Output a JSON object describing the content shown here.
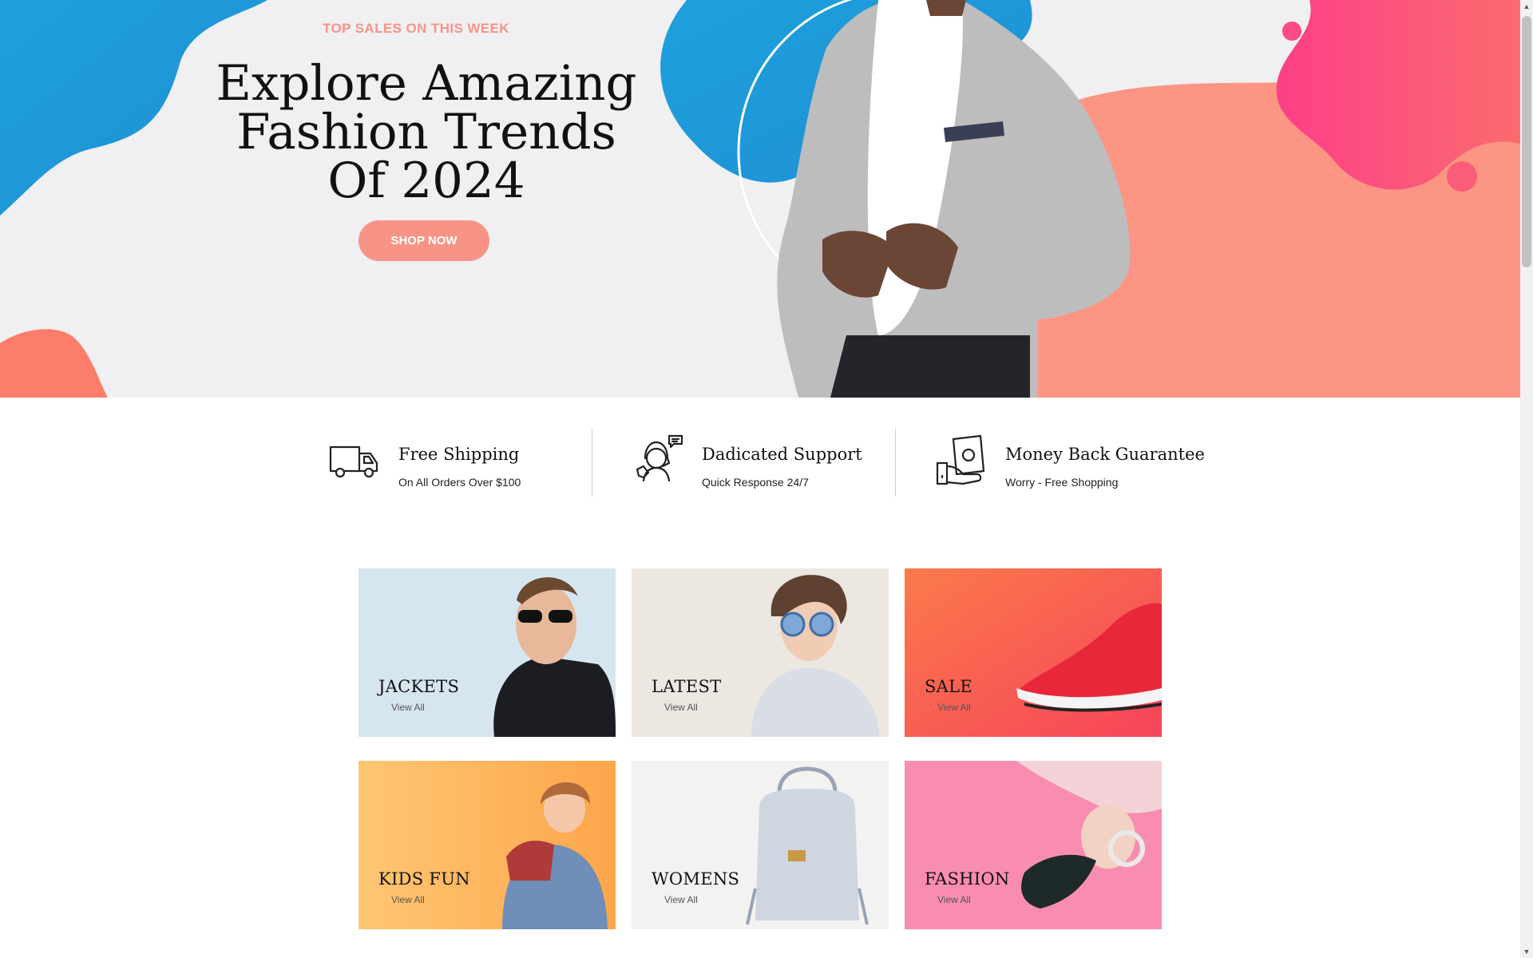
{
  "hero": {
    "eyebrow": "TOP SALES ON THIS WEEK",
    "title_lines": [
      "Explore Amazing",
      "Fashion Trends",
      "Of 2024"
    ],
    "cta_label": "SHOP NOW"
  },
  "features": [
    {
      "icon": "delivery-truck-icon",
      "title": "Free Shipping",
      "subtitle": "On All Orders Over $100"
    },
    {
      "icon": "support-agent-icon",
      "title": "Dadicated Support",
      "subtitle": "Quick Response 24/7"
    },
    {
      "icon": "money-back-icon",
      "title": "Money Back Guarantee",
      "subtitle": "Worry - Free Shopping"
    }
  ],
  "categories": [
    {
      "name": "JACKETS",
      "link": "View All"
    },
    {
      "name": "LATEST",
      "link": "View All"
    },
    {
      "name": "SALE",
      "link": "View All"
    },
    {
      "name": "KIDS FUN",
      "link": "View All"
    },
    {
      "name": "WOMENS",
      "link": "View All"
    },
    {
      "name": "FASHION",
      "link": "View All"
    }
  ],
  "colors": {
    "accent": "#f79486",
    "blob_blue": "#1ea0dc",
    "blob_pink": "#fb4b8a",
    "blob_peach": "#fc9584"
  }
}
